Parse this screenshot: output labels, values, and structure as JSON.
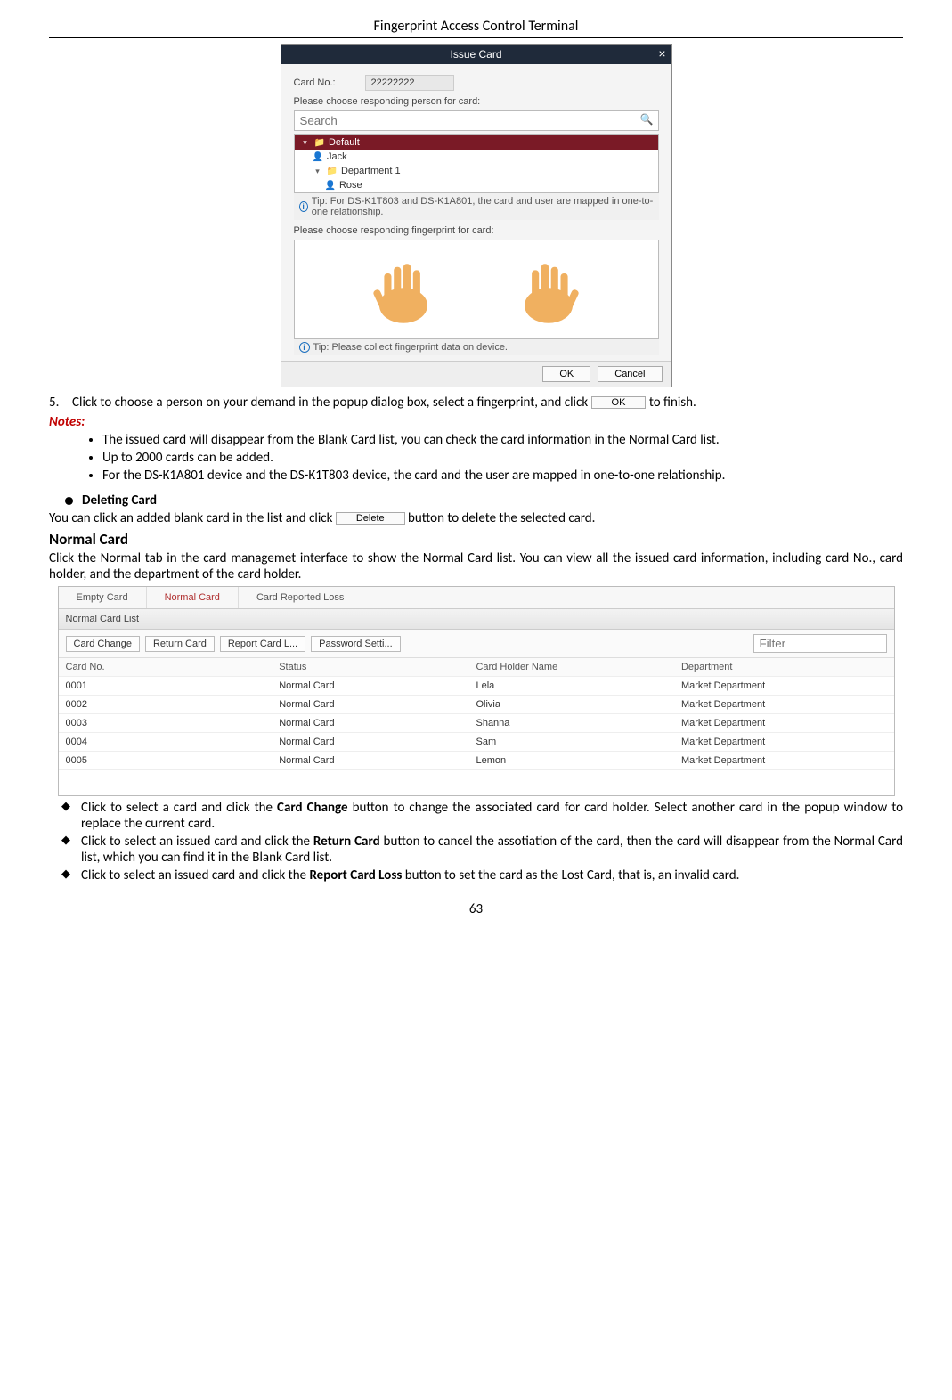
{
  "header": {
    "title": "Fingerprint Access Control Terminal"
  },
  "pagenum": "63",
  "dialog": {
    "title": "Issue Card",
    "cardno_label": "Card No.:",
    "cardno_value": "22222222",
    "choose_person": "Please choose responding person for card:",
    "search_placeholder": "Search",
    "tree": {
      "default": "Default",
      "jack": "Jack",
      "dept1": "Department 1",
      "rose": "Rose"
    },
    "tip1": "Tip: For DS-K1T803 and DS-K1A801, the card and user are mapped in one-to-one relationship.",
    "choose_fp": "Please choose responding fingerprint for card:",
    "tip2": "Tip: Please collect fingerprint data on device.",
    "ok": "OK",
    "cancel": "Cancel"
  },
  "step5": {
    "num": "5.",
    "text_a": "Click to choose a person on your demand in the popup dialog box, select a fingerprint, and click ",
    "btn": "OK",
    "text_b": " to finish."
  },
  "notes_label": "Notes:",
  "notes": {
    "n1": "The issued card will disappear from the Blank Card list, you can check the card information in the Normal Card list.",
    "n2": "Up to 2000 cards can be added.",
    "n3": "For the DS-K1A801 device and the DS-K1T803 device, the card and the user are mapped in one-to-one relationship."
  },
  "deleting": {
    "heading": "Deleting Card",
    "text_a": "You can click an added blank card in the list and click ",
    "btn": "Delete",
    "text_b": " button to delete the selected card."
  },
  "normal": {
    "heading": "Normal Card",
    "para": "Click the Normal tab in the card managemet interface to show the Normal Card list. You can view all the issued card information, including card No., card holder, and the department of the card holder."
  },
  "table": {
    "tabs": {
      "empty": "Empty Card",
      "normal": "Normal Card",
      "lost": "Card Reported Loss"
    },
    "list_header": "Normal Card List",
    "toolbar": {
      "change": "Card Change",
      "ret": "Return Card",
      "report": "Report Card L...",
      "pwd": "Password Setti...",
      "filter": "Filter"
    },
    "cols": {
      "c1": "Card No.",
      "c2": "Status",
      "c3": "Card Holder Name",
      "c4": "Department"
    },
    "rows": [
      {
        "c1": "0001",
        "c2": "Normal Card",
        "c3": "Lela",
        "c4": "Market Department"
      },
      {
        "c1": "0002",
        "c2": "Normal Card",
        "c3": "Olivia",
        "c4": "Market Department"
      },
      {
        "c1": "0003",
        "c2": "Normal Card",
        "c3": "Shanna",
        "c4": "Market Department"
      },
      {
        "c1": "0004",
        "c2": "Normal Card",
        "c3": "Sam",
        "c4": "Market Department"
      },
      {
        "c1": "0005",
        "c2": "Normal Card",
        "c3": "Lemon",
        "c4": "Market Department"
      }
    ]
  },
  "diamond": {
    "d1a": "Click to select a card and click the ",
    "d1b": "Card Change",
    "d1c": " button to change the associated card for card holder. Select another card in the popup window to replace the current card.",
    "d2a": "Click to select an issued card and click the ",
    "d2b": "Return Card",
    "d2c": " button to cancel the assotiation of the card, then the card will disappear from the Normal Card list, which you can find it in the Blank Card list.",
    "d3a": "Click to select an issued card and click the ",
    "d3b": "Report Card Loss",
    "d3c": " button to set the card as the Lost Card, that is, an invalid card."
  }
}
